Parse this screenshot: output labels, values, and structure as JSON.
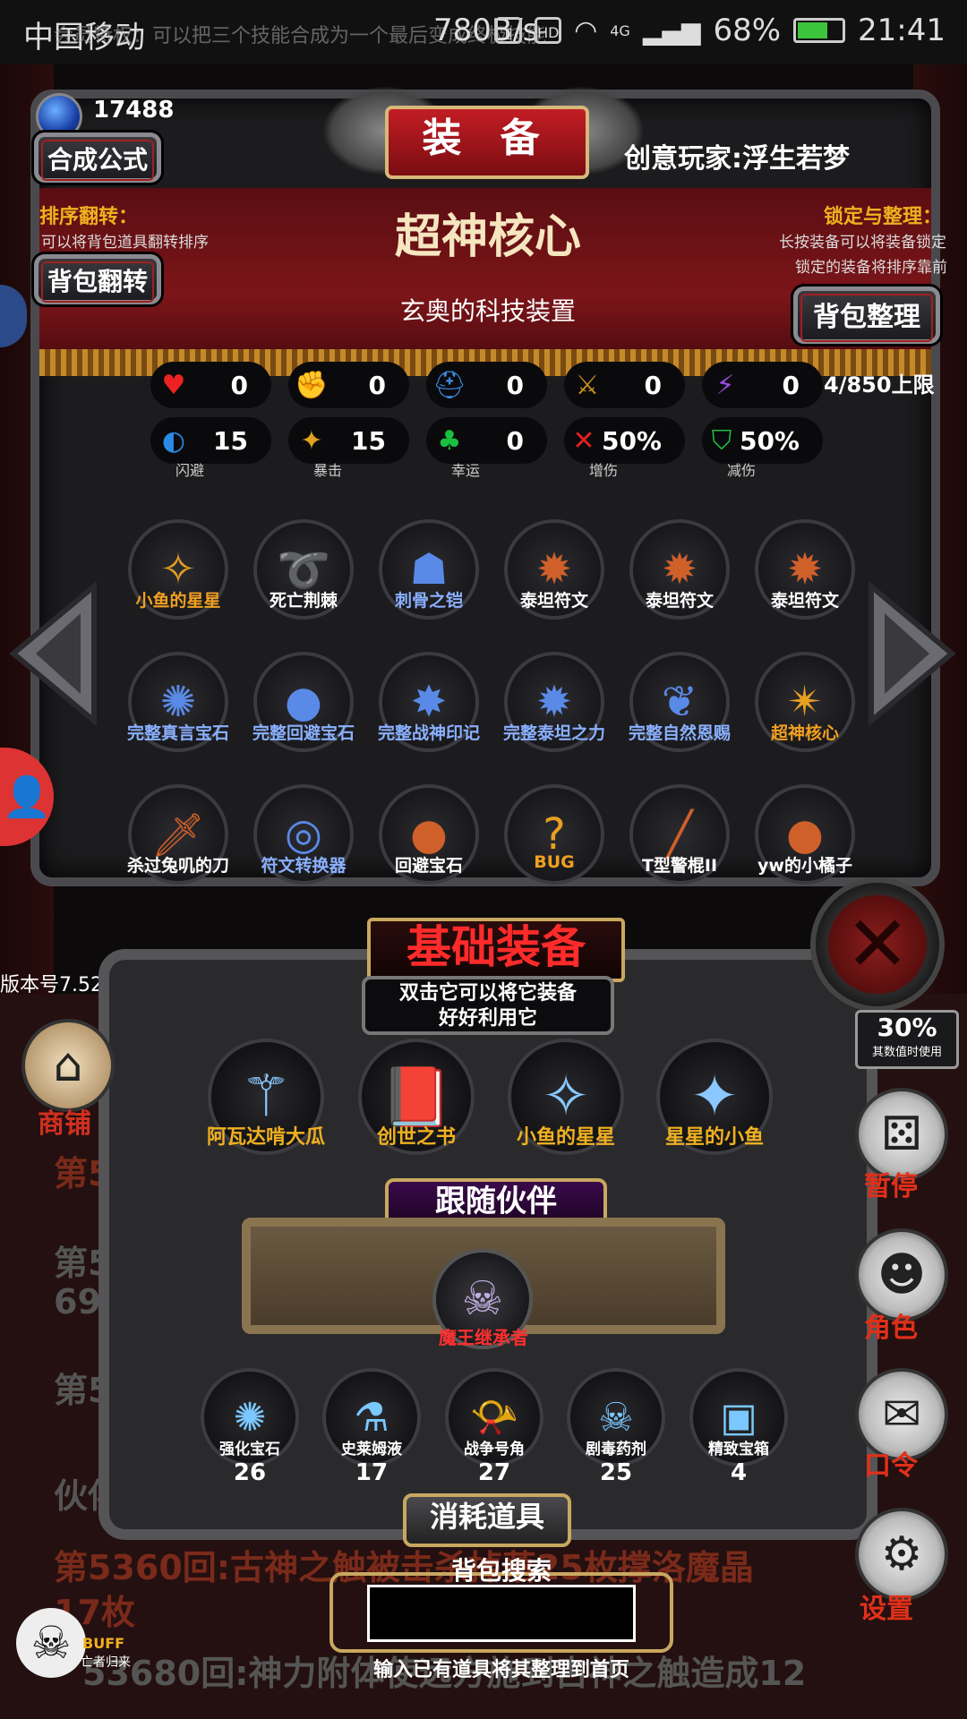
{
  "status_bar": {
    "carrier": "中国移动",
    "notice": "会员特权：可以把三个技能合成为一个最后变成终极技能",
    "speed": "780B/s",
    "network": "4G",
    "battery": "68%",
    "battery_level": 0.68,
    "time": "21:41"
  },
  "header": {
    "gem_count": "17488",
    "compose_button": "合成公式",
    "title": "装 备",
    "creator_label": "创意玩家:浮生若梦"
  },
  "sort_hint": {
    "title": "排序翻转：",
    "text": "可以将背包道具翻转排序",
    "button": "背包翻转"
  },
  "lock_hint": {
    "title": "锁定与整理：",
    "text1": "长按装备可以将装备锁定",
    "text2": "锁定的装备将排序靠前",
    "button": "背包整理"
  },
  "selected_item": {
    "name": "超神核心",
    "desc": "玄奥的科技装置"
  },
  "stats_row1": [
    {
      "icon": "heart-icon",
      "glyph": "♥",
      "color": "#e22",
      "value": "0"
    },
    {
      "icon": "strength-icon",
      "glyph": "✊",
      "color": "#e8c020",
      "value": "0"
    },
    {
      "icon": "helmet-icon",
      "glyph": "⛑",
      "color": "#3a8ae0",
      "value": "0"
    },
    {
      "icon": "sword-icon",
      "glyph": "⚔",
      "color": "#c89020",
      "value": "0"
    },
    {
      "icon": "lightning-icon",
      "glyph": "⚡",
      "color": "#9a4ae0",
      "value": "0"
    }
  ],
  "stats_row2": [
    {
      "icon": "dodge-icon",
      "glyph": "◐",
      "color": "#2a8ae8",
      "value": "15",
      "label": "闪避"
    },
    {
      "icon": "crit-icon",
      "glyph": "✦",
      "color": "#e0a020",
      "value": "15",
      "label": "暴击"
    },
    {
      "icon": "clover-icon",
      "glyph": "♣",
      "color": "#1ac040",
      "value": "0",
      "label": "幸运"
    },
    {
      "icon": "damage-up-icon",
      "glyph": "✕",
      "color": "#e02020",
      "value": "50%",
      "label": "增伤"
    },
    {
      "icon": "damage-down-icon",
      "glyph": "⛉",
      "color": "#20c040",
      "value": "50%",
      "label": "减伤"
    }
  ],
  "capacity": "4/850上限",
  "inventory": [
    {
      "name": "小鱼的星星",
      "glyph": "✧",
      "color": "gold"
    },
    {
      "name": "死亡荆棘",
      "glyph": "➰",
      "color": "white"
    },
    {
      "name": "刺骨之铠",
      "glyph": "☗",
      "color": "blue"
    },
    {
      "name": "泰坦符文",
      "glyph": "✹",
      "color": "white"
    },
    {
      "name": "泰坦符文",
      "glyph": "✹",
      "color": "white"
    },
    {
      "name": "泰坦符文",
      "glyph": "✹",
      "color": "white"
    },
    {
      "name": "完整真言宝石",
      "glyph": "✺",
      "color": "blue"
    },
    {
      "name": "完整回避宝石",
      "glyph": "●",
      "color": "blue"
    },
    {
      "name": "完整战神印记",
      "glyph": "✸",
      "color": "blue"
    },
    {
      "name": "完整泰坦之力",
      "glyph": "✹",
      "color": "blue"
    },
    {
      "name": "完整自然恩赐",
      "glyph": "❦",
      "color": "blue"
    },
    {
      "name": "超神核心",
      "glyph": "✴",
      "color": "gold"
    },
    {
      "name": "杀过兔叽的刀",
      "glyph": "🗡",
      "color": "white"
    },
    {
      "name": "符文转换器",
      "glyph": "◎",
      "color": "blue"
    },
    {
      "name": "回避宝石",
      "glyph": "●",
      "color": "white"
    },
    {
      "name": "BUG",
      "glyph": "?",
      "color": "gold"
    },
    {
      "name": "T型警棍II",
      "glyph": "╱",
      "color": "white"
    },
    {
      "name": "yw的小橘子",
      "glyph": "●",
      "color": "white"
    }
  ],
  "basic_equip": {
    "title": "基础装备",
    "desc1": "双击它可以将它装备",
    "desc2": "好好利用它",
    "items": [
      {
        "name": "阿瓦达啃大瓜",
        "glyph": "⚚"
      },
      {
        "name": "创世之书",
        "glyph": "📕"
      },
      {
        "name": "小鱼的星星",
        "glyph": "✧"
      },
      {
        "name": "星星的小鱼",
        "glyph": "✦"
      }
    ]
  },
  "companion": {
    "title": "跟随伙伴",
    "name": "魔王继承者",
    "glyph": "☠"
  },
  "consumables": {
    "title": "消耗道具",
    "items": [
      {
        "name": "强化宝石",
        "glyph": "✺",
        "count": "26"
      },
      {
        "name": "史莱姆液",
        "glyph": "⚗",
        "count": "17"
      },
      {
        "name": "战争号角",
        "glyph": "📯",
        "count": "27"
      },
      {
        "name": "剧毒药剂",
        "glyph": "☠",
        "count": "25"
      },
      {
        "name": "精致宝箱",
        "glyph": "▣",
        "count": "4"
      }
    ]
  },
  "search": {
    "title": "背包搜索",
    "value": "",
    "hint": "输入已有道具将其整理到首页"
  },
  "side_menu": {
    "shop": "商铺",
    "pause": "暂停",
    "character": "角色",
    "code": "口令",
    "settings": "设置",
    "speed_label": "其数值时使用",
    "speed_value": "30%"
  },
  "version": "版本号7.52",
  "buff": {
    "label": "BUFF",
    "sub": "亡者归来"
  },
  "log": {
    "line1": "第5",
    "line2": "第53",
    "line3": "690",
    "line4": "第53",
    "line5": "伙伴",
    "line6": "第5360回:古神之触被击杀掉落25枚撑洛魔晶",
    "line7": "17枚",
    "line8": "53680回:神力附体使远方施到古神之触造成12"
  }
}
